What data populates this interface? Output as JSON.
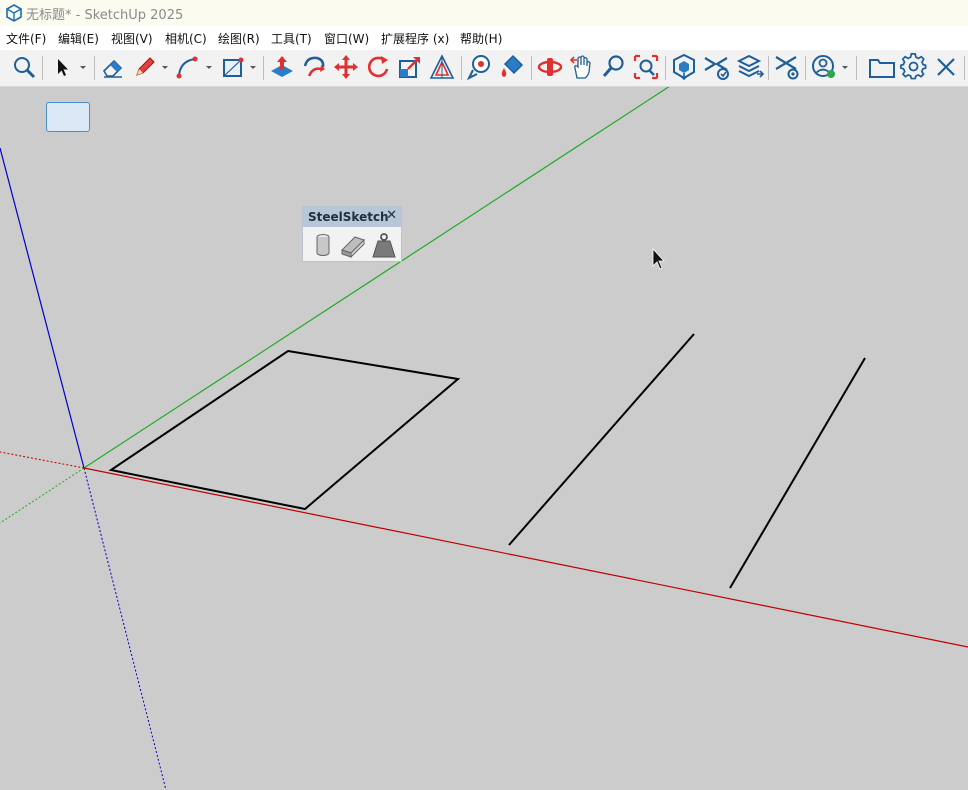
{
  "window": {
    "title": "无标题* - SketchUp 2025"
  },
  "menu": [
    {
      "label": "文件(F)"
    },
    {
      "label": "编辑(E)"
    },
    {
      "label": "视图(V)"
    },
    {
      "label": "相机(C)"
    },
    {
      "label": "绘图(R)"
    },
    {
      "label": "工具(T)"
    },
    {
      "label": "窗口(W)"
    },
    {
      "label": "扩展程序 (x)"
    },
    {
      "label": "帮助(H)"
    }
  ],
  "toolbar": {
    "active_tool": "select",
    "tools": [
      "zoom-icon",
      "select-icon",
      "eraser-icon",
      "pencil-icon",
      "arc-icon",
      "rectangle-icon",
      "push-pull-icon",
      "follow-me-icon",
      "move-icon",
      "rotate-icon",
      "scale-icon",
      "offset-icon",
      "tape-measure-icon",
      "paint-bucket-icon",
      "orbit-icon",
      "pan-icon",
      "zoom-icon",
      "zoom-extents-icon",
      "warehouse-icon",
      "extension-manager-icon",
      "layers-icon",
      "model-settings-icon",
      "account-icon",
      "folder-icon",
      "settings-icon",
      "close-icon"
    ]
  },
  "steelsketch": {
    "title": "SteelSketch",
    "close": "✕",
    "tools": [
      "cylinder-profile-icon",
      "beam-profile-icon",
      "weight-icon"
    ]
  },
  "colors": {
    "x_axis": "#c00000",
    "y_axis": "#00aa00",
    "z_axis": "#0000cc",
    "canvas": "#cccccc",
    "edges": "#000000"
  }
}
